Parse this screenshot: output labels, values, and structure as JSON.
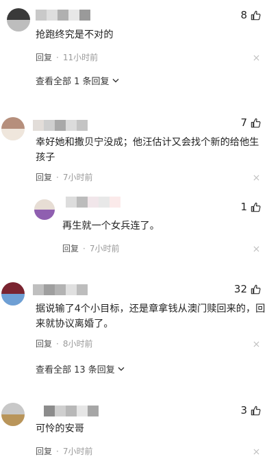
{
  "comments": [
    {
      "likes": "8",
      "text": "抢跑终究是不对的",
      "reply_label": "回复",
      "time": "11小时前",
      "expand_label": "查看全部 1 条回复",
      "avatar_colors": [
        "#3a3a3a",
        "#bdbdbd"
      ],
      "name_mosaic": [
        "#c9c9c9",
        "#dedede",
        "#b0b0b0",
        "#e7e7e7",
        "#9a9a9a"
      ]
    },
    {
      "likes": "7",
      "text": "幸好她和撒贝宁没成；他汪估计又会找个新的给他生\n孩子",
      "reply_label": "回复",
      "time": "7小时前",
      "avatar_colors": [
        "#b68f7c",
        "#efe6dc"
      ],
      "name_mosaic": [
        "#e2ddd9",
        "#cfcfcf",
        "#a9a9a9",
        "#dcdcdc",
        "#c4c4c4"
      ]
    },
    {
      "likes": "1",
      "text": "再生就一个女兵连了。",
      "reply_label": "回复",
      "time": "7小时前",
      "avatar_colors": [
        "#e7ddd4",
        "#8f5fb0"
      ],
      "name_mosaic": [
        "#dddddd",
        "#bcbcbc",
        "#f1e6ea",
        "#e8e8e8",
        "#fbeaea"
      ]
    },
    {
      "likes": "32",
      "text": "据说输了4个小目标，还是章拿钱从澳门赎回来的，回\n来就协议离婚了。",
      "reply_label": "回复",
      "time": "8小时前",
      "expand_label": "查看全部 13 条回复",
      "avatar_colors": [
        "#7a2430",
        "#6e9fd4"
      ],
      "name_mosaic": [
        "#bfbfbf",
        "#9f9f9f",
        "#b3b3b3",
        "#e0e0e0",
        "#bdbdbd"
      ]
    },
    {
      "likes": "3",
      "text": "可怜的安哥",
      "reply_label": "回复",
      "time": "7小时前",
      "avatar_colors": [
        "#c8c8c8",
        "#b9955a"
      ],
      "name_mosaic": [
        "#8c8c8c",
        "#cfcfcf",
        "#b8b8b8",
        "#e6e6e6",
        "#a6a6a6"
      ]
    }
  ]
}
